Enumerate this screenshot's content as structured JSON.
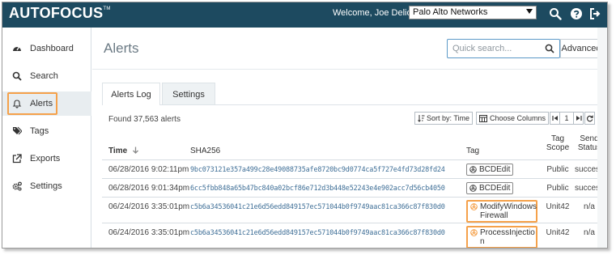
{
  "app": {
    "logo": "AUTOFOCUS",
    "logo_tm": "TM",
    "welcome": "Welcome, Joe Delio",
    "org_select": "Palo Alto Networks"
  },
  "icons": {
    "search": "search-icon",
    "help": "help-icon",
    "logout": "logout-icon"
  },
  "sidebar": {
    "items": [
      {
        "label": "Dashboard",
        "icon": "dashboard-icon"
      },
      {
        "label": "Search",
        "icon": "search-icon"
      },
      {
        "label": "Alerts",
        "icon": "bell-icon"
      },
      {
        "label": "Tags",
        "icon": "tags-icon"
      },
      {
        "label": "Exports",
        "icon": "external-link-icon"
      },
      {
        "label": "Settings",
        "icon": "cogs-icon"
      }
    ],
    "active_index": 2
  },
  "main": {
    "title": "Alerts",
    "search": {
      "placeholder": "Quick search..."
    },
    "advanced_label": "Advanced"
  },
  "tabs": [
    {
      "label": "Alerts Log",
      "active": true
    },
    {
      "label": "Settings",
      "active": false
    }
  ],
  "toolbar": {
    "found_text": "Found 37,563 alerts",
    "sort_label": "Sort by: Time",
    "columns_label": "Choose Columns",
    "page_number": "1"
  },
  "table": {
    "headers": {
      "time": "Time",
      "sha256": "SHA256",
      "tag": "Tag",
      "tag_scope_line1": "Tag",
      "tag_scope_line2": "Scope",
      "send_status_line1": "Send",
      "send_status_line2": "Status"
    },
    "rows": [
      {
        "time": "06/28/2016 9:02:11pm",
        "sha256": "9bc073121e357a499c28e49088735afe8720bc9d0774ca5f727e4fd73d28fd24",
        "tag": "BCDEdit",
        "scope": "Public",
        "status": "success"
      },
      {
        "time": "06/28/2016 9:01:34pm",
        "sha256": "6cc5fbb848a65b47bc840a02bcf86e712d3b448e52243e4e902acc7d56cb4050",
        "tag": "BCDEdit",
        "scope": "Public",
        "status": "success"
      },
      {
        "time": "06/24/2016 3:35:01pm",
        "sha256": "c5b6a34536041c21e6d56edd849157ec571044b0f9749aac81ca366c87f830d0",
        "tag_line1": "ModifyWindows",
        "tag_line2": "Firewall",
        "scope": "Unit42",
        "status": "n/a"
      },
      {
        "time": "06/24/2016 3:35:01pm",
        "sha256": "c5b6a34536041c21e6d56edd849157ec571044b0f9749aac81ca366c87f830d0",
        "tag_line1": "ProcessInjectio",
        "tag_line2": "n",
        "scope": "Unit42",
        "status": "n/a"
      }
    ]
  },
  "colors": {
    "topbar": "#1d4a60",
    "highlight": "#f5a14a",
    "hash_link": "#3f6f97"
  }
}
